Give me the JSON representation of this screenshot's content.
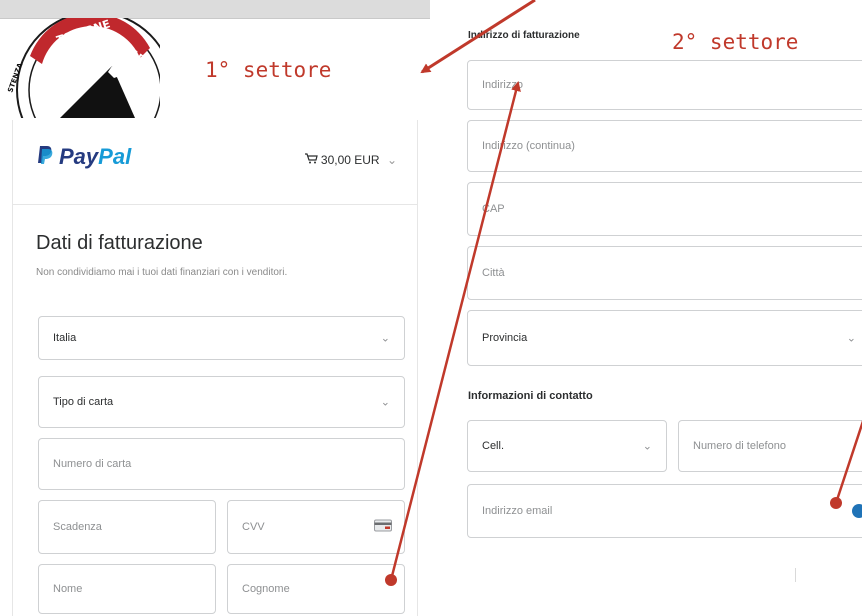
{
  "annotations": {
    "sector1": "1° settore",
    "sector2": "2° settore"
  },
  "logo": {
    "text": "TAVERNE D'ARSTA",
    "side_text": "STENZA"
  },
  "paypal": {
    "brand_pay": "Pay",
    "brand_pal": "Pal",
    "cart_amount": "30,00 EUR",
    "cart_icon": "cart-icon",
    "colors": {
      "pay": "#253b80",
      "pal": "#179bd7"
    }
  },
  "billing": {
    "title": "Dati di fatturazione",
    "subtitle": "Non condividiamo mai i tuoi dati finanziari con i venditori.",
    "country_value": "Italia",
    "card_type_value": "Tipo di carta",
    "card_number_placeholder": "Numero di carta",
    "expiry_placeholder": "Scadenza",
    "cvv_placeholder": "CVV",
    "first_name_placeholder": "Nome",
    "last_name_placeholder": "Cognome"
  },
  "address": {
    "section_title": "Indirizzo di fatturazione",
    "address_placeholder": "Indirizzo",
    "address2_placeholder": "Indirizzo (continua)",
    "zip_placeholder": "CAP",
    "city_placeholder": "Città",
    "province_value": "Provincia"
  },
  "contact": {
    "section_title": "Informazioni di contatto",
    "phone_type_value": "Cell.",
    "phone_placeholder": "Numero di telefono",
    "email_placeholder": "Indirizzo email"
  },
  "accent_color": "#c0392b"
}
